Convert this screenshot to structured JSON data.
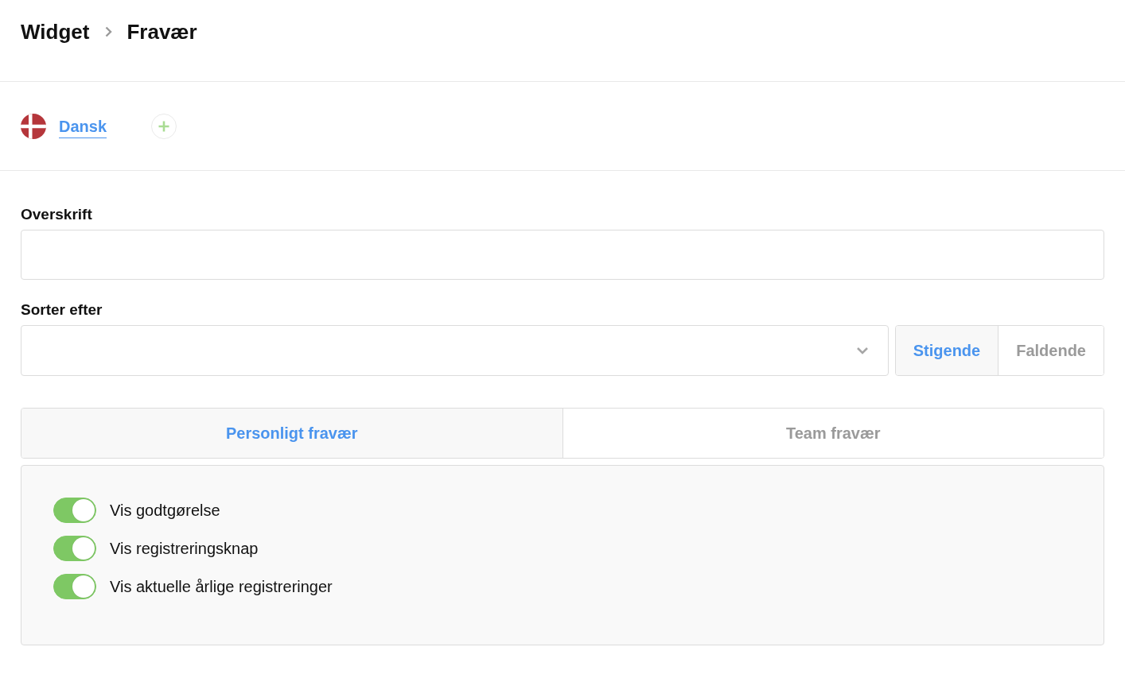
{
  "breadcrumb": [
    {
      "label": "Widget"
    },
    {
      "label": "Fravær"
    }
  ],
  "languages": [
    {
      "label": "Dansk",
      "selected": true
    }
  ],
  "heading_field": {
    "label": "Overskrift"
  },
  "sort": {
    "label": "Sorter efter",
    "options": [
      {
        "label": "Stigende",
        "selected": true
      },
      {
        "label": "Faldende",
        "selected": false
      }
    ]
  },
  "tabs": [
    {
      "label": "Personligt fravær",
      "selected": true
    },
    {
      "label": "Team fravær",
      "selected": false
    }
  ],
  "toggles": [
    {
      "label": "Vis godtgørelse",
      "on": true
    },
    {
      "label": "Vis registreringsknap",
      "on": true
    },
    {
      "label": "Vis aktuelle årlige registreringer",
      "on": true
    }
  ]
}
